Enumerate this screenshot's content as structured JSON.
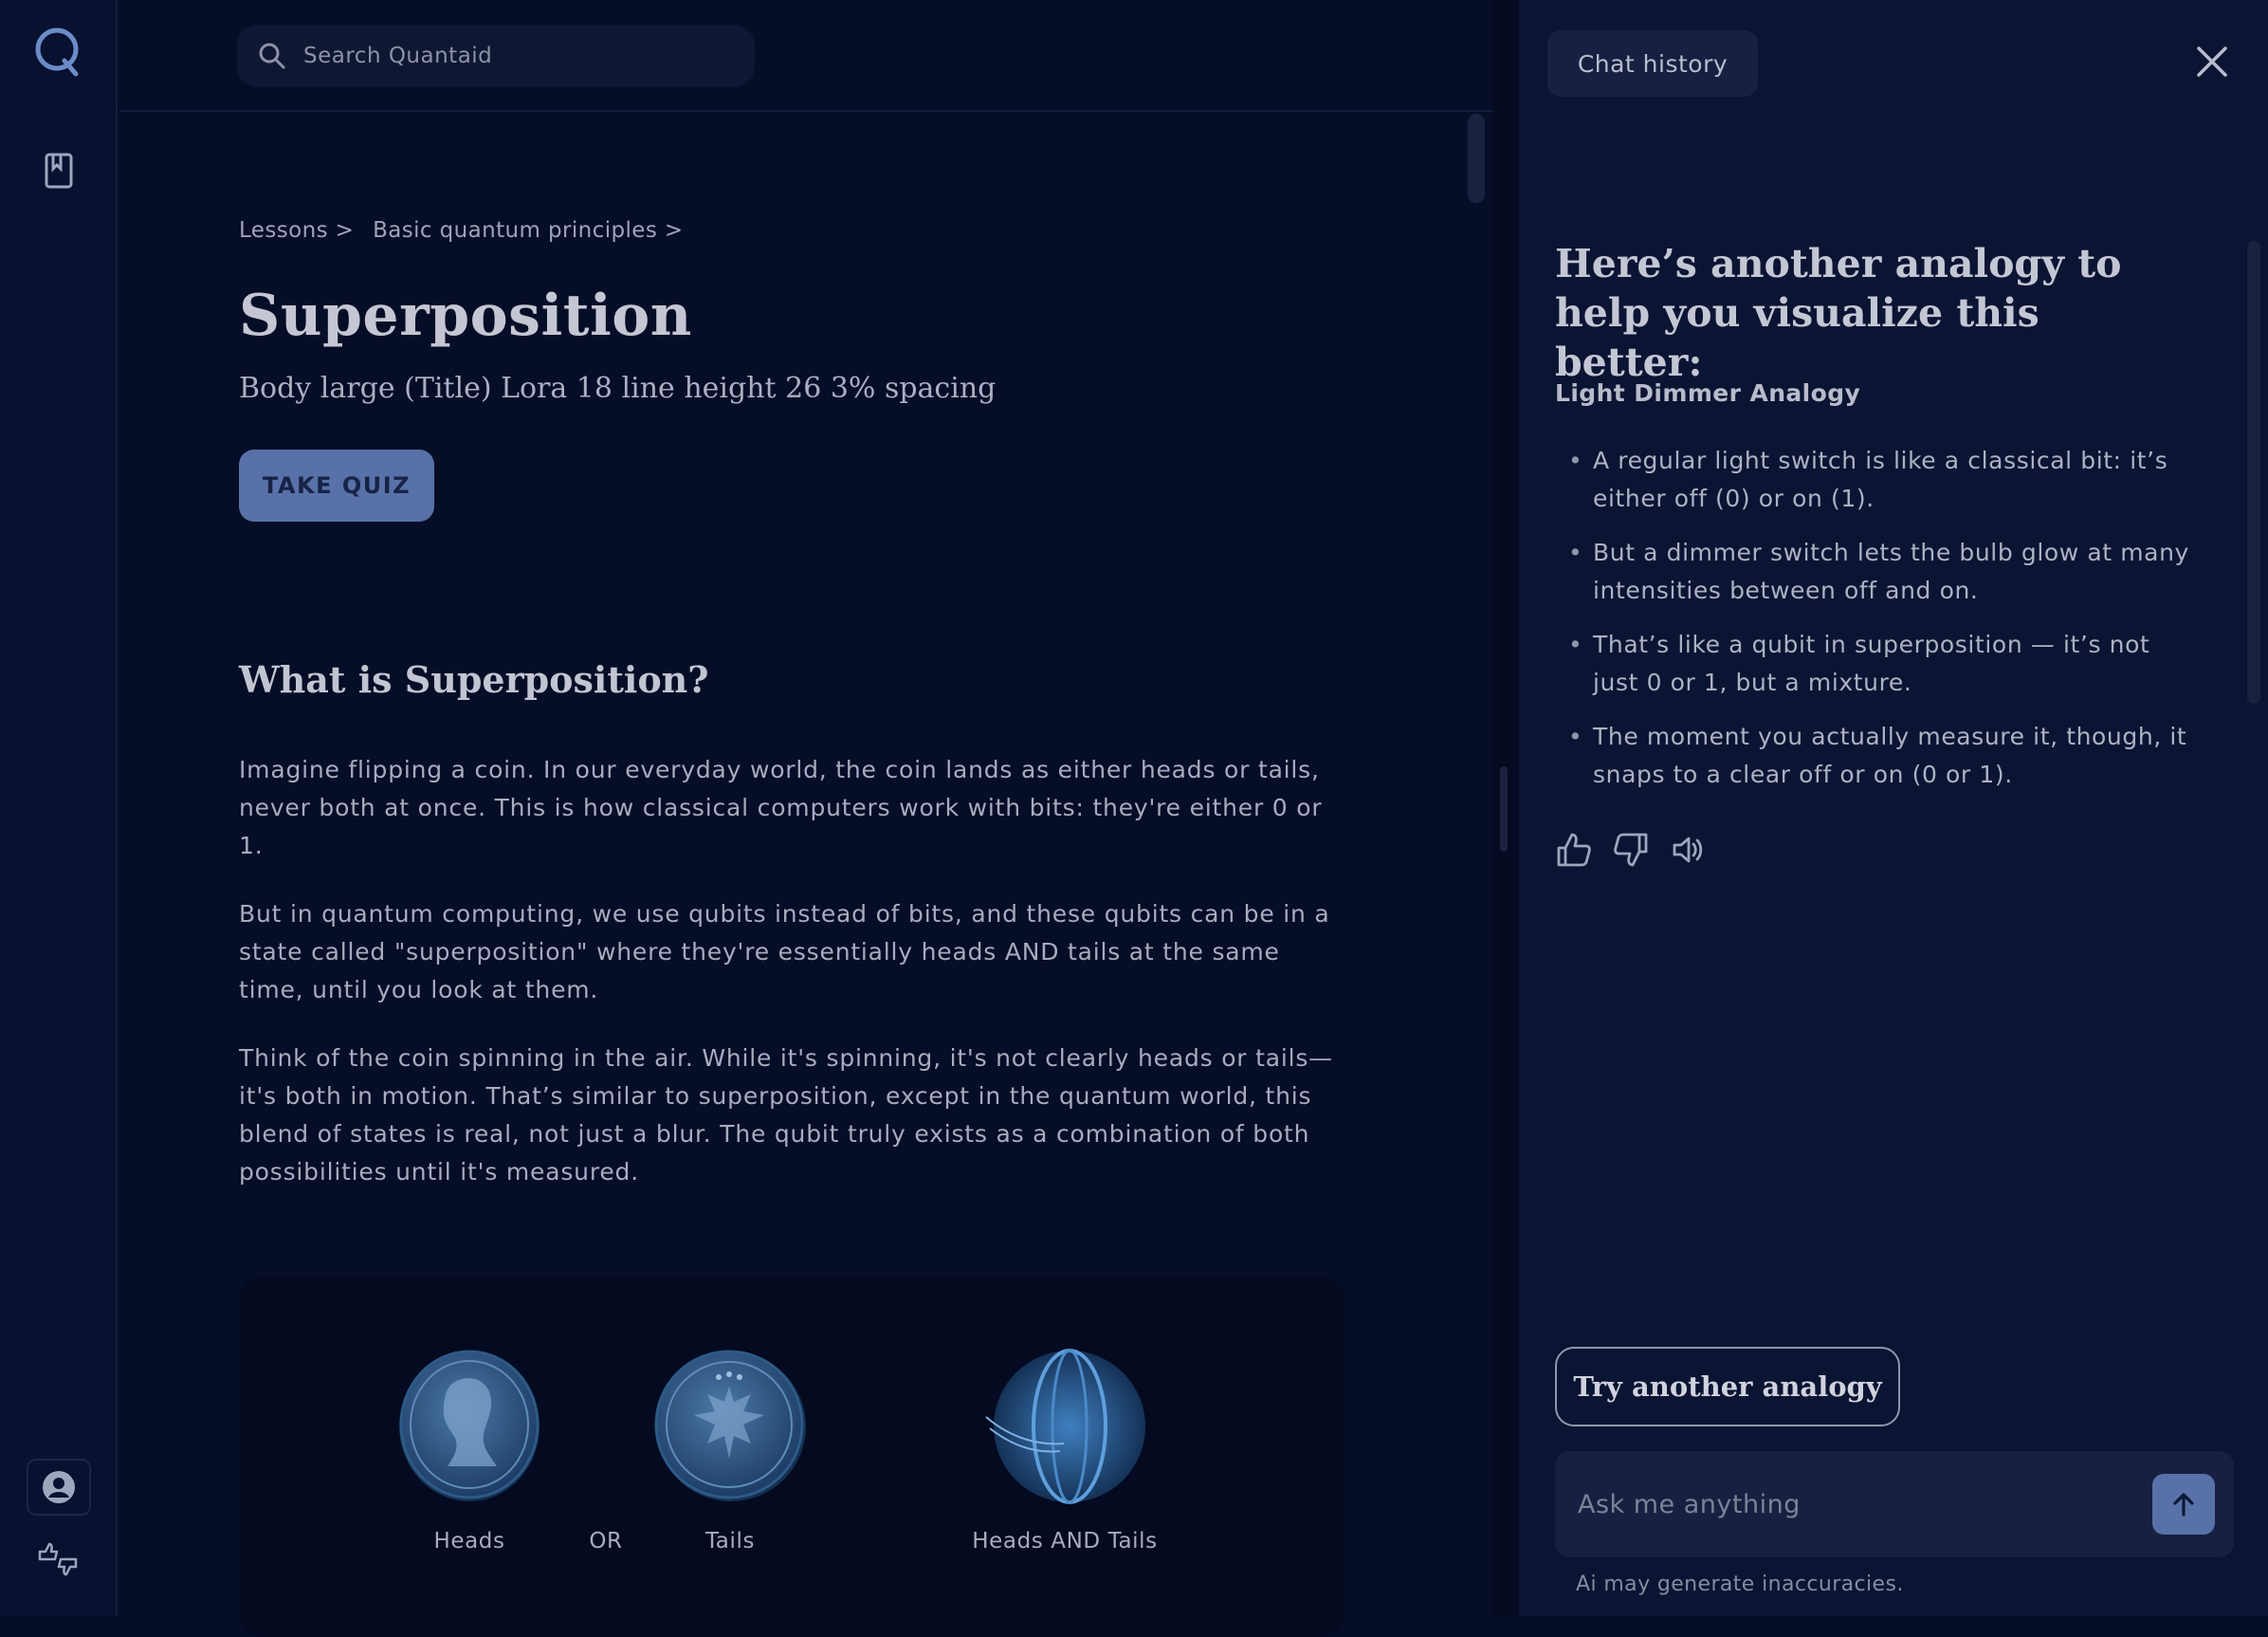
{
  "app": {
    "logo_letter": "Q"
  },
  "search": {
    "placeholder": "Search Quantaid"
  },
  "breadcrumb": {
    "items": [
      "Lessons >",
      "Basic quantum principles >"
    ]
  },
  "lesson": {
    "title": "Superposition",
    "subtitle": "Body large (Title) Lora 18 line height 26 3% spacing",
    "quiz_button": "TAKE QUIZ",
    "section_title": "What is Superposition?",
    "paragraphs": [
      "Imagine flipping a coin. In our everyday world, the coin lands as either heads or tails, never both at once. This is how classical computers work with bits: they're either 0 or 1.",
      "But in quantum computing, we use qubits instead of bits, and these qubits can be in a state called \"superposition\" where they're essentially heads AND tails at the same time, until you look at them.",
      "Think of the coin spinning in the air. While it's spinning, it's not clearly heads or tails—it's both in motion. That’s similar to superposition, except in the quantum world, this blend of states is real, not just a blur. The qubit truly exists as a combination of both possibilities until it's measured."
    ],
    "coins": {
      "heads": "Heads",
      "or": "OR",
      "tails": "Tails",
      "both": "Heads AND Tails"
    }
  },
  "chat": {
    "history_button": "Chat history",
    "heading": "Here’s another analogy to help you visualize this better:",
    "analogy_title": "Light Dimmer Analogy",
    "bullets": [
      "A regular light switch is like a classical bit: it’s either off (0) or on (1).",
      "But a dimmer switch lets the bulb glow at many intensities between off and on.",
      "That’s like a qubit in superposition — it’s not just 0 or 1, but a mixture.",
      "The moment you actually measure it, though, it snaps to a clear off or on (0 or 1)."
    ],
    "try_button": "Try another analogy",
    "input_placeholder": "Ask me anything",
    "disclaimer": "Ai may generate inaccuracies."
  },
  "colors": {
    "accent": "#5871a8",
    "background": "#060d26",
    "panel": "#0c1433"
  }
}
